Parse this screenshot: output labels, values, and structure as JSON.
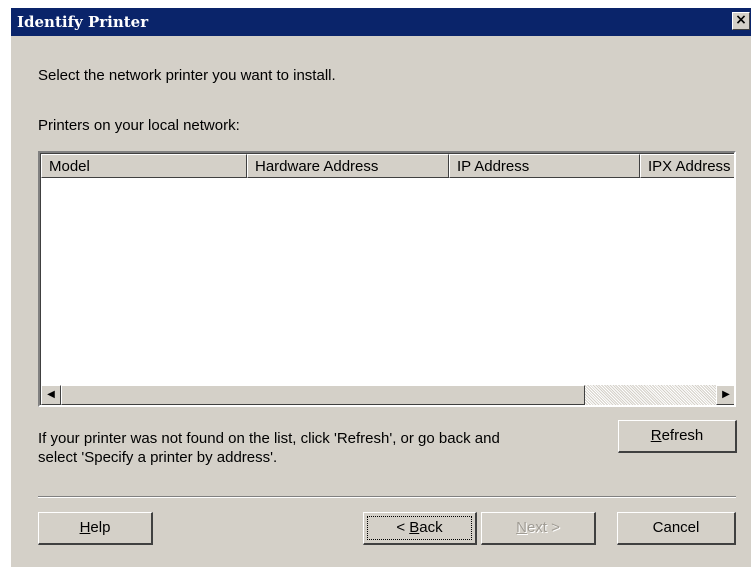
{
  "window": {
    "title": "Identify Printer",
    "close_glyph": "×"
  },
  "content": {
    "instruction": "Select the network printer you want to install.",
    "list_label": "Printers on your local network:",
    "not_found_line1": "If your printer was not found on the list, click 'Refresh', or go back and",
    "not_found_line2": "select 'Specify a printer by address'."
  },
  "printer_list": {
    "columns": [
      "Model",
      "Hardware Address",
      "IP Address",
      "IPX Address"
    ],
    "rows": []
  },
  "scrollbar": {
    "left_glyph": "◀",
    "right_glyph": "▶"
  },
  "buttons": {
    "refresh": {
      "mnemonic": "R",
      "rest": "efresh"
    },
    "help": {
      "mnemonic": "H",
      "rest": "elp"
    },
    "back": {
      "prefix": "< ",
      "mnemonic": "B",
      "rest": "ack"
    },
    "next": {
      "mnemonic": "N",
      "rest": "ext >"
    },
    "cancel": "Cancel"
  },
  "colors": {
    "titlebar": "#0a246a",
    "dialog_face": "#d4d0c8",
    "list_background": "#ffffff"
  }
}
